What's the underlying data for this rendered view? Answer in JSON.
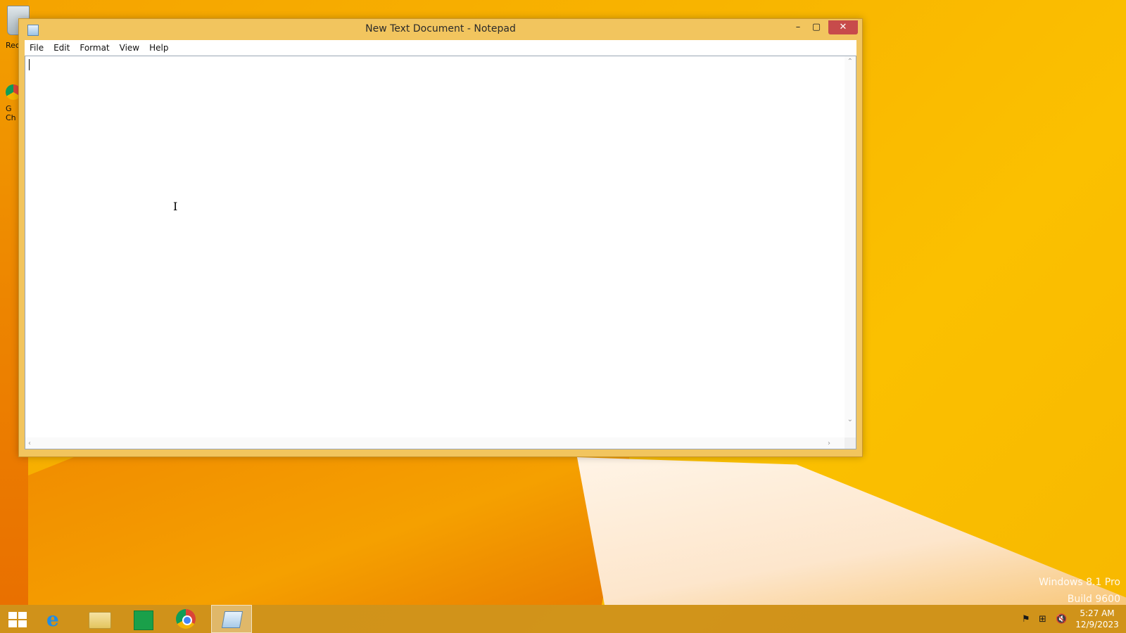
{
  "desktop": {
    "recycle_bin_label": "Rec",
    "chrome_shortcut_label": "G\nCh"
  },
  "window": {
    "title": "New Text Document - Notepad",
    "minimize_glyph": "–",
    "maximize_glyph": "▢",
    "close_glyph": "✕"
  },
  "menu": {
    "items": [
      {
        "label": "File"
      },
      {
        "label": "Edit"
      },
      {
        "label": "Format"
      },
      {
        "label": "View"
      },
      {
        "label": "Help"
      }
    ]
  },
  "editor": {
    "content": "",
    "ibeam_glyph": "I",
    "scroll_up": "⌃",
    "scroll_down": "⌄",
    "scroll_left": "‹",
    "scroll_right": "›"
  },
  "watermark": {
    "line1": "Windows 8.1 Pro",
    "line2": "Build 9600"
  },
  "taskbar": {
    "ie_glyph": "e",
    "tray": {
      "flag": "⚑",
      "network": "⊞",
      "volume": "🔇"
    },
    "clock": {
      "time": "5:27 AM",
      "date": "12/9/2023"
    }
  },
  "colors": {
    "desktop_accent": "#f8b400",
    "window_frame": "#f2c55e",
    "close_button": "#c74b4b",
    "taskbar": "#c98c1e"
  }
}
